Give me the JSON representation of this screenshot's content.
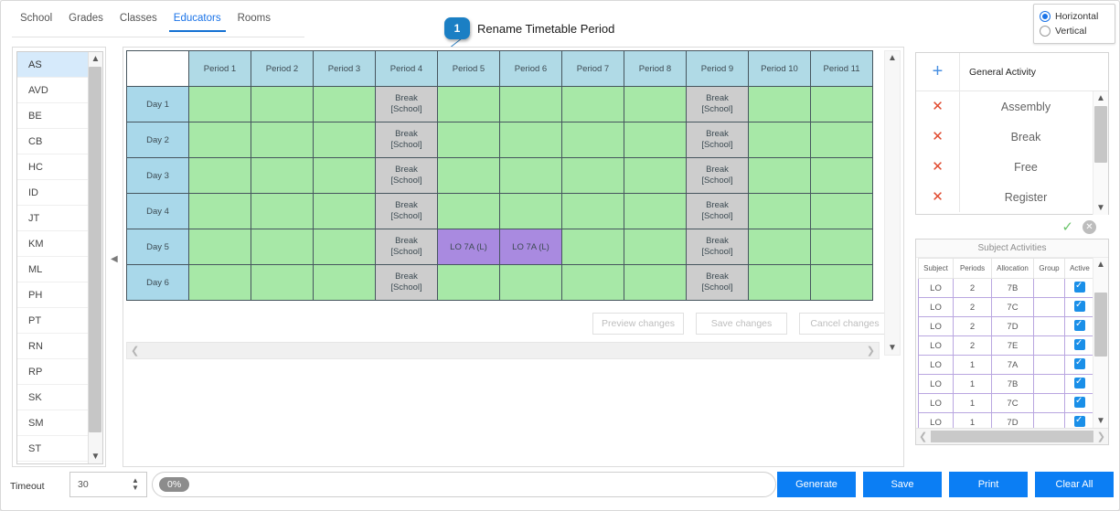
{
  "tabs": [
    {
      "label": "School",
      "active": false
    },
    {
      "label": "Grades",
      "active": false
    },
    {
      "label": "Classes",
      "active": false
    },
    {
      "label": "Educators",
      "active": true
    },
    {
      "label": "Rooms",
      "active": false
    }
  ],
  "orientation": {
    "horizontal_label": "Horizontal",
    "vertical_label": "Vertical",
    "selected": "Horizontal"
  },
  "callout": {
    "number": "1",
    "text": "Rename Timetable Period"
  },
  "educators": {
    "selected": "AS",
    "items": [
      "AS",
      "AVD",
      "BE",
      "CB",
      "HC",
      "ID",
      "JT",
      "KM",
      "ML",
      "PH",
      "PT",
      "RN",
      "RP",
      "SK",
      "SM",
      "ST"
    ]
  },
  "timetable": {
    "corner": "",
    "period_headers": [
      "Period 1",
      "Period 2",
      "Period 3",
      "Period 4",
      "Period 5",
      "Period 6",
      "Period 7",
      "Period 8",
      "Period 9",
      "Period 10",
      "Period 11"
    ],
    "day_headers": [
      "Day 1",
      "Day 2",
      "Day 3",
      "Day 4",
      "Day 5",
      "Day 6"
    ],
    "break_label_line1": "Break",
    "break_label_line2": "[School]",
    "rows": [
      [
        "free",
        "free",
        "free",
        "break",
        "free",
        "free",
        "free",
        "free",
        "break",
        "free",
        "free"
      ],
      [
        "free",
        "free",
        "free",
        "break",
        "free",
        "free",
        "free",
        "free",
        "break",
        "free",
        "free"
      ],
      [
        "free",
        "free",
        "free",
        "break",
        "free",
        "free",
        "free",
        "free",
        "break",
        "free",
        "free"
      ],
      [
        "free",
        "free",
        "free",
        "break",
        "free",
        "free",
        "free",
        "free",
        "break",
        "free",
        "free"
      ],
      [
        "free",
        "free",
        "free",
        "break",
        "LO 7A (L)",
        "LO 7A (L)",
        "free",
        "free",
        "break",
        "free",
        "free"
      ],
      [
        "free",
        "free",
        "free",
        "break",
        "free",
        "free",
        "free",
        "free",
        "break",
        "free",
        "free"
      ]
    ]
  },
  "change_buttons": [
    {
      "label": "Preview changes"
    },
    {
      "label": "Save changes"
    },
    {
      "label": "Cancel changes"
    }
  ],
  "general_activity": {
    "title": "General Activity",
    "add_icon": "+",
    "items": [
      "Assembly",
      "Break",
      "Free",
      "Register"
    ]
  },
  "subject_activities": {
    "title": "Subject Activities",
    "columns": [
      "Subject",
      "Periods",
      "Allocation",
      "Group",
      "Active"
    ],
    "rows": [
      {
        "subject": "LO",
        "periods": "2",
        "allocation": "7B",
        "group": "",
        "active": true
      },
      {
        "subject": "LO",
        "periods": "2",
        "allocation": "7C",
        "group": "",
        "active": true
      },
      {
        "subject": "LO",
        "periods": "2",
        "allocation": "7D",
        "group": "",
        "active": true
      },
      {
        "subject": "LO",
        "periods": "2",
        "allocation": "7E",
        "group": "",
        "active": true
      },
      {
        "subject": "LO",
        "periods": "1",
        "allocation": "7A",
        "group": "",
        "active": true
      },
      {
        "subject": "LO",
        "periods": "1",
        "allocation": "7B",
        "group": "",
        "active": true
      },
      {
        "subject": "LO",
        "periods": "1",
        "allocation": "7C",
        "group": "",
        "active": true
      },
      {
        "subject": "LO",
        "periods": "1",
        "allocation": "7D",
        "group": "",
        "active": true
      }
    ]
  },
  "bottom": {
    "timeout_label": "Timeout",
    "timeout_value": "30",
    "progress_text": "0%",
    "buttons": [
      "Generate",
      "Save",
      "Print",
      "Clear All"
    ]
  },
  "colors": {
    "accent": "#0b7ef4",
    "tab_active": "#1a73e8",
    "free_cell": "#a7e8a7",
    "break_cell": "#cdcdcd",
    "activity_cell": "#a98ae0",
    "header_cell": "#b0dae6",
    "day_cell": "#a9d8ea",
    "delete_icon": "#e0492e",
    "checkbox": "#1a8fe8"
  }
}
